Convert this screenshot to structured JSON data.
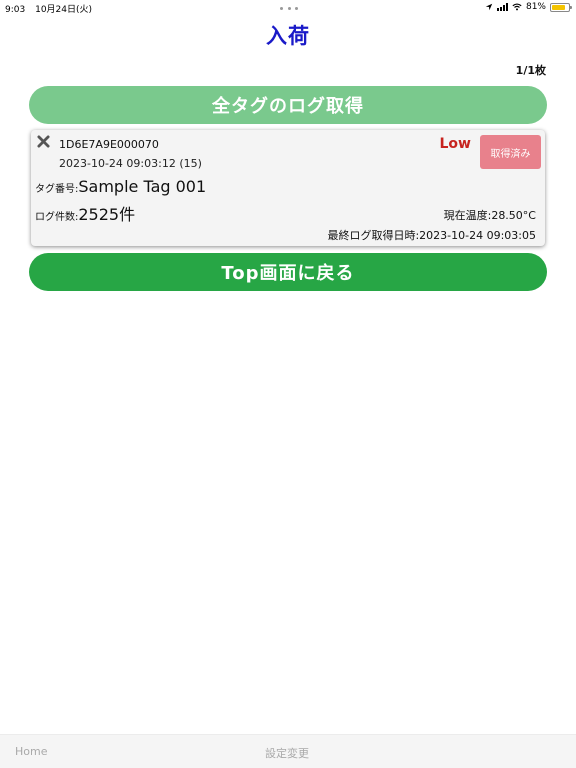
{
  "status_bar": {
    "time": "9:03",
    "date": "10月24日(火)",
    "battery": "81%",
    "battery_level": 0.81
  },
  "header": {
    "title": "入荷",
    "page_count": "1/1枚"
  },
  "actions": {
    "get_all_logs_label": "全タグのログ取得",
    "back_to_top_label": "Top画面に戻る"
  },
  "tag_card": {
    "tag_id": "1D6E7A9E000070",
    "datetime": "2023-10-24 09:03:12 (15)",
    "level": "Low",
    "status_badge": "取得済み",
    "tag_number_label": "タグ番号:",
    "tag_number_value": "Sample Tag 001",
    "log_count_label": "ログ件数:",
    "log_count_value": "2525件",
    "current_temp": "現在温度:28.50°C",
    "last_log": "最終ログ取得日時:2023-10-24 09:03:05"
  },
  "bottom_bar": {
    "home_label": "Home",
    "settings_label": "設定変更"
  },
  "colors": {
    "title": "#1a1ac8",
    "get_all_button": "#7ac98d",
    "top_button": "#27a645",
    "level_low": "#c7231e",
    "badge": "#e8818c"
  }
}
